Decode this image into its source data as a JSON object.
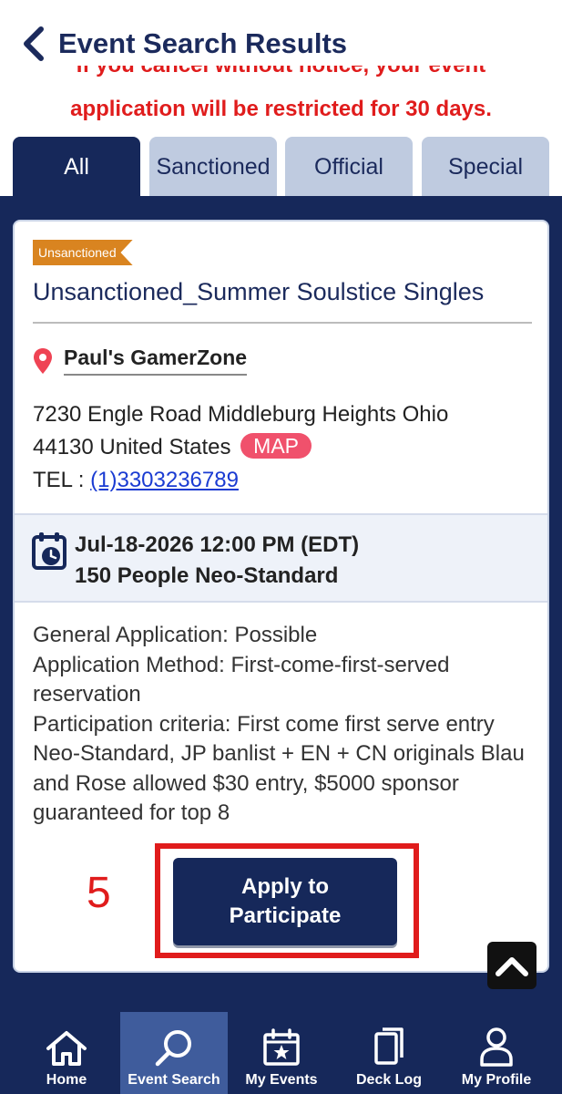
{
  "header": {
    "title": "Event Search Results",
    "warning_line1": "If you cancel without notice, your event",
    "warning_line2": "application will be restricted for 30 days."
  },
  "tabs": [
    {
      "label": "All",
      "active": true
    },
    {
      "label": "Sanctioned",
      "active": false
    },
    {
      "label": "Official",
      "active": false
    },
    {
      "label": "Special",
      "active": false
    }
  ],
  "event": {
    "badge": "Unsanctioned",
    "title": "Unsanctioned_Summer Soulstice Singles",
    "venue": "Paul's GamerZone",
    "address_line1": "7230 Engle Road Middleburg Heights Ohio",
    "address_line2": "44130 United States",
    "map_label": "MAP",
    "tel_label": "TEL : ",
    "tel_value": "(1)3303236789",
    "date_time": "Jul-18-2026 12:00 PM (EDT)",
    "capacity_format": "150 People Neo-Standard",
    "general_application": "General Application: Possible",
    "application_method": "Application Method: First-come-first-served reservation",
    "participation_criteria": "Participation criteria: First come first serve entry Neo-Standard, JP banlist + EN + CN originals Blau and Rose allowed $30 entry, $5000 sponsor guaranteed for top 8"
  },
  "annotation": {
    "step_number": "5"
  },
  "apply_button": {
    "line1": "Apply to",
    "line2": "Participate"
  },
  "bottom_nav": [
    {
      "label": "Home",
      "icon": "home-icon",
      "active": false
    },
    {
      "label": "Event Search",
      "icon": "search-icon",
      "active": true
    },
    {
      "label": "My Events",
      "icon": "calendar-star-icon",
      "active": false
    },
    {
      "label": "Deck Log",
      "icon": "cards-icon",
      "active": false
    },
    {
      "label": "My Profile",
      "icon": "person-icon",
      "active": false
    }
  ],
  "colors": {
    "navy": "#16285a",
    "tab_inactive": "#bfcbe0",
    "warning_red": "#e01c1c",
    "badge_orange": "#d98420",
    "map_pink": "#f0516c",
    "nav_active": "#3f5c9c"
  }
}
